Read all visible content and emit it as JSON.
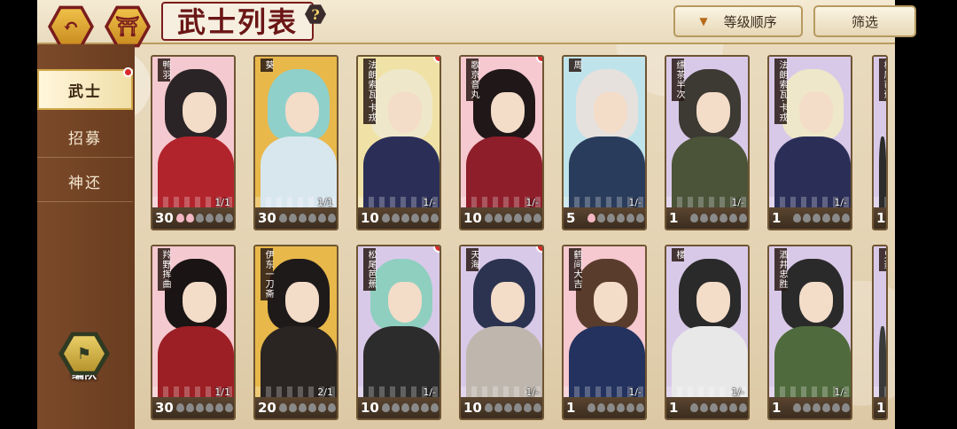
{
  "header": {
    "title": "武士列表",
    "back_icon": "↶",
    "home_icon": "⛩",
    "help_label": "?",
    "sort_label": "等级顺序",
    "filter_label": "筛选"
  },
  "sidebar": {
    "items": [
      {
        "label": "武士",
        "active": true,
        "badge": true
      },
      {
        "label": "招募",
        "active": false,
        "badge": false
      },
      {
        "label": "神还",
        "active": false,
        "badge": false
      }
    ],
    "team_label": "编队"
  },
  "colors": {
    "accent": "#7a1c1c",
    "gold": "#d4a942",
    "badge": "#d72b2b"
  },
  "cards": [
    {
      "name": "鸭羽",
      "level": "30",
      "count": "1/1",
      "pips_on": 2,
      "badge": false,
      "bg": "#f4c9cf",
      "hair": "#2a2426",
      "body": "#b2242c"
    },
    {
      "name": "葵",
      "level": "30",
      "count": "1/1",
      "pips_on": 0,
      "badge": false,
      "bg": "#e8b84a",
      "hair": "#8fd0cb",
      "body": "#d8e6ee"
    },
    {
      "name": "法朗索瓦·卡戎",
      "level": "10",
      "count": "1/-",
      "pips_on": 0,
      "badge": true,
      "bg": "#f0e2a6",
      "hair": "#efe7c9",
      "body": "#2b2f58"
    },
    {
      "name": "歌京音丸",
      "level": "10",
      "count": "1/-",
      "pips_on": 0,
      "badge": true,
      "bg": "#f6c8cf",
      "hair": "#1f1718",
      "body": "#8e1e2a"
    },
    {
      "name": "周",
      "level": "5",
      "count": "1/-",
      "pips_on": 1,
      "badge": false,
      "bg": "#bfe3ea",
      "hair": "#e6e1dd",
      "body": "#2a3c5c"
    },
    {
      "name": "缥茶半次",
      "level": "1",
      "count": "1/-",
      "pips_on": 0,
      "badge": false,
      "bg": "#d9c9e8",
      "hair": "#3c3a33",
      "body": "#4b5339"
    },
    {
      "name": "法朗索瓦·卡戎",
      "level": "1",
      "count": "1/-",
      "pips_on": 0,
      "badge": false,
      "bg": "#d9c9e8",
      "hair": "#efe7c9",
      "body": "#2b2f58"
    },
    {
      "name": "松尾芭蕉",
      "level": "1",
      "count": "",
      "pips_on": 0,
      "badge": false,
      "bg": "#d9c9e8",
      "hair": "#8fcfc0",
      "body": "#2c2c2c",
      "partial": true
    },
    {
      "name": "羚野挥曲",
      "level": "30",
      "count": "1/1",
      "pips_on": 0,
      "badge": false,
      "bg": "#f4c9cf",
      "hair": "#1a1414",
      "body": "#9b1f24"
    },
    {
      "name": "伊东一刀斋",
      "level": "20",
      "count": "2/1",
      "pips_on": 0,
      "badge": false,
      "bg": "#e8b84a",
      "hair": "#1e1a1a",
      "body": "#2a2522"
    },
    {
      "name": "松尾芭蕉",
      "level": "10",
      "count": "1/-",
      "pips_on": 0,
      "badge": true,
      "bg": "#d9c9e8",
      "hair": "#8fcfc0",
      "body": "#2c2c2c"
    },
    {
      "name": "天海",
      "level": "10",
      "count": "1/-",
      "pips_on": 0,
      "badge": true,
      "bg": "#d9c9e8",
      "hair": "#2b3350",
      "body": "#bfb6ad"
    },
    {
      "name": "鹤间大吉",
      "level": "1",
      "count": "1/-",
      "pips_on": 0,
      "badge": false,
      "bg": "#f6c8cf",
      "hair": "#5a3c2c",
      "body": "#23325e"
    },
    {
      "name": "楼",
      "level": "1",
      "count": "1/-",
      "pips_on": 0,
      "badge": false,
      "bg": "#d9c9e8",
      "hair": "#2a2a2a",
      "body": "#e8e8e8"
    },
    {
      "name": "酒井忠胜",
      "level": "1",
      "count": "1/-",
      "pips_on": 0,
      "badge": false,
      "bg": "#d9c9e8",
      "hair": "#2a2a2a",
      "body": "#4f6a3c"
    },
    {
      "name": "鬼菱",
      "level": "1",
      "count": "",
      "pips_on": 0,
      "badge": false,
      "bg": "#d9c9e8",
      "hair": "#2a2a2a",
      "body": "#3a3a3a",
      "partial": true
    }
  ]
}
